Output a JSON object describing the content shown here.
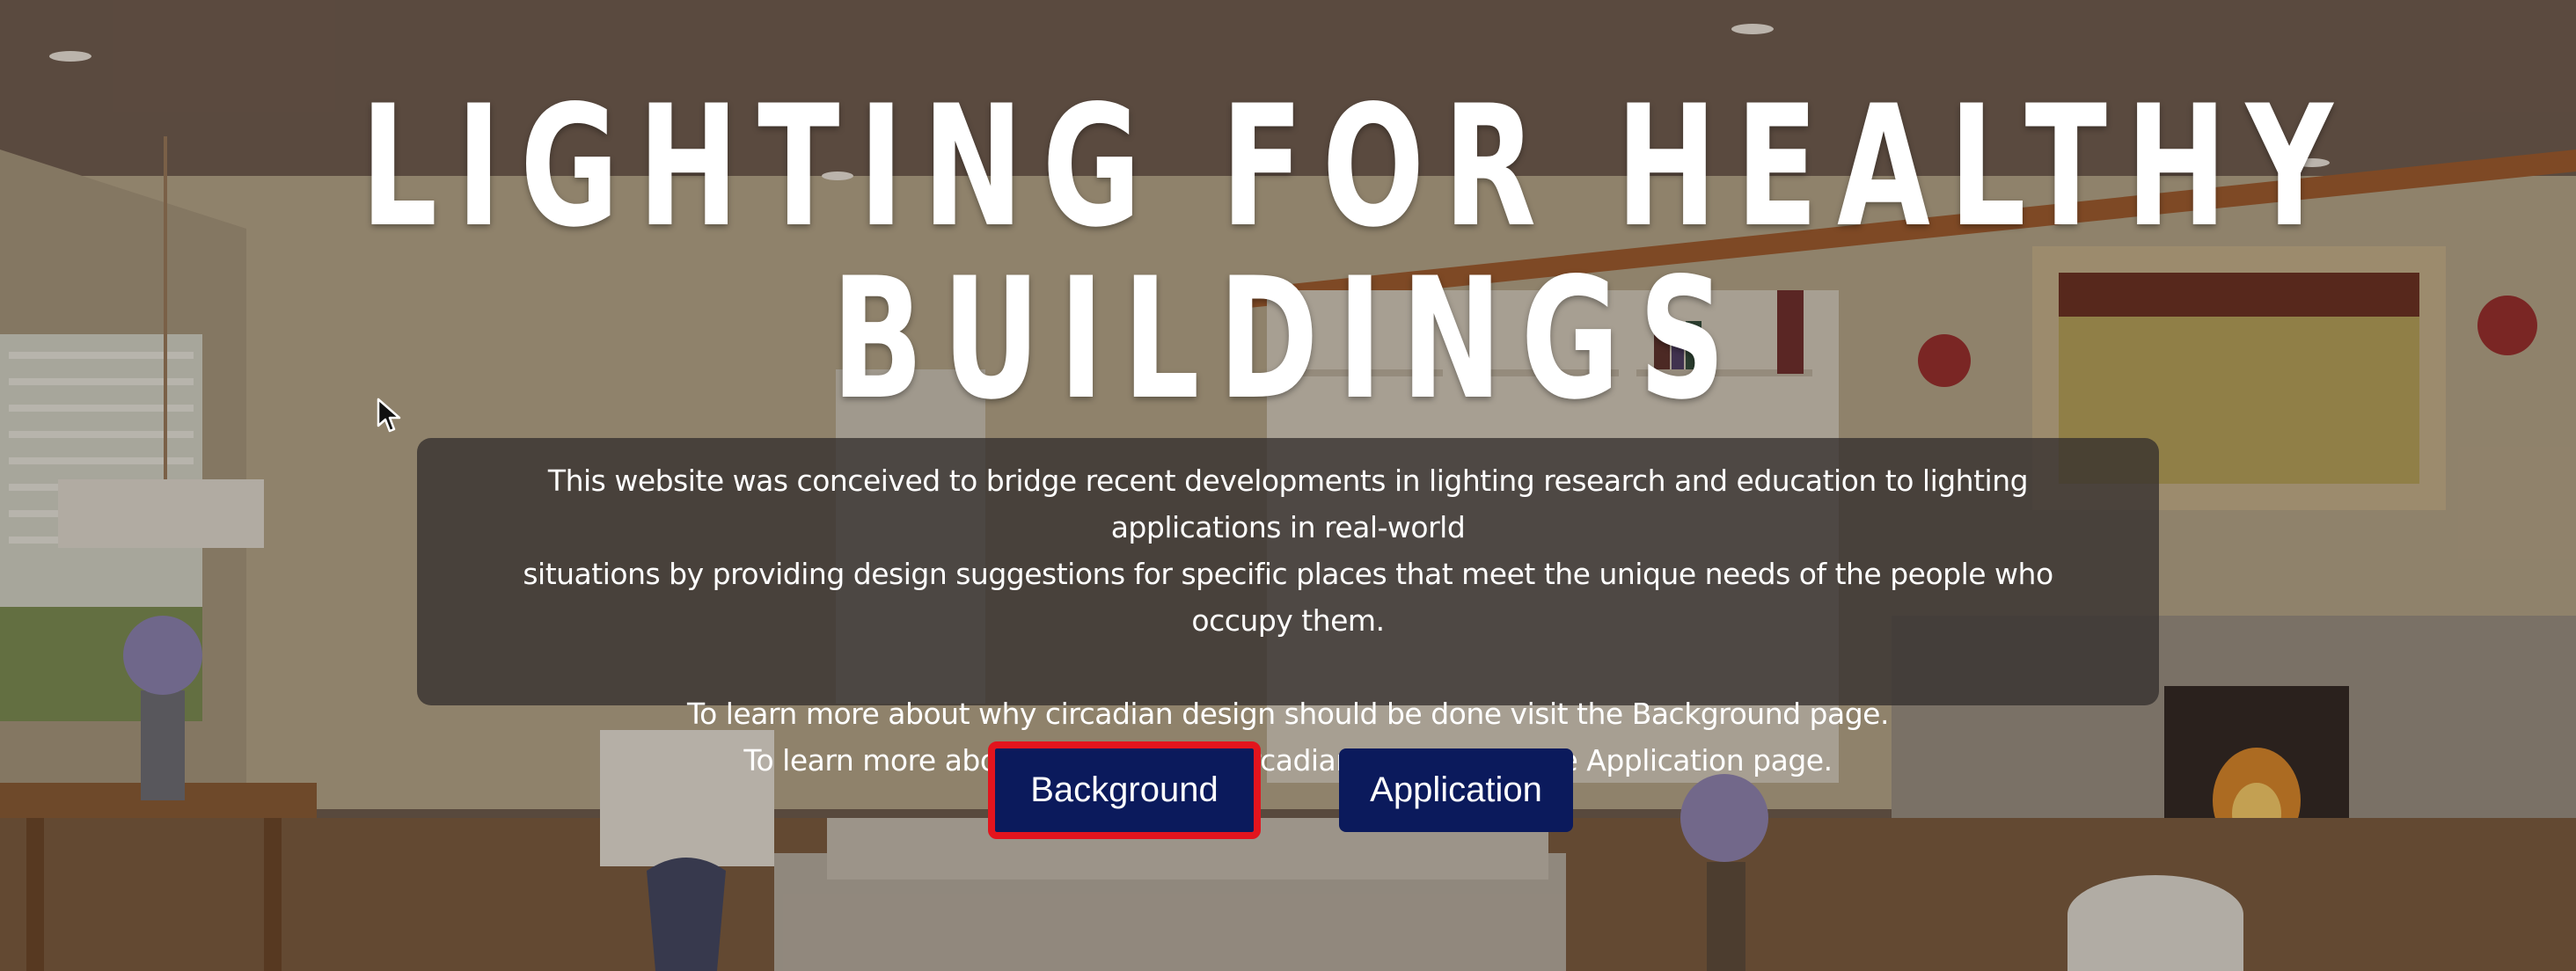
{
  "hero": {
    "title_line1": "LIGHTING FOR HEALTHY",
    "title_line2": "BUILDINGS"
  },
  "intro": {
    "paragraph1_line1": "This website was conceived to bridge recent developments in lighting research and education to lighting applications in real-world",
    "paragraph1_line2": "situations by providing design suggestions for specific places that meet the unique needs of the people who occupy them.",
    "paragraph2_line1": "To learn more about why circadian design should be done visit the Background page.",
    "paragraph2_line2": "To learn more about how to apply circadian design visit the Application page."
  },
  "buttons": {
    "background_label": "Background",
    "application_label": "Application",
    "button_color": "#0b1a5c",
    "highlight_color": "#e3141d"
  },
  "cursor_icon": "arrow-cursor-icon"
}
